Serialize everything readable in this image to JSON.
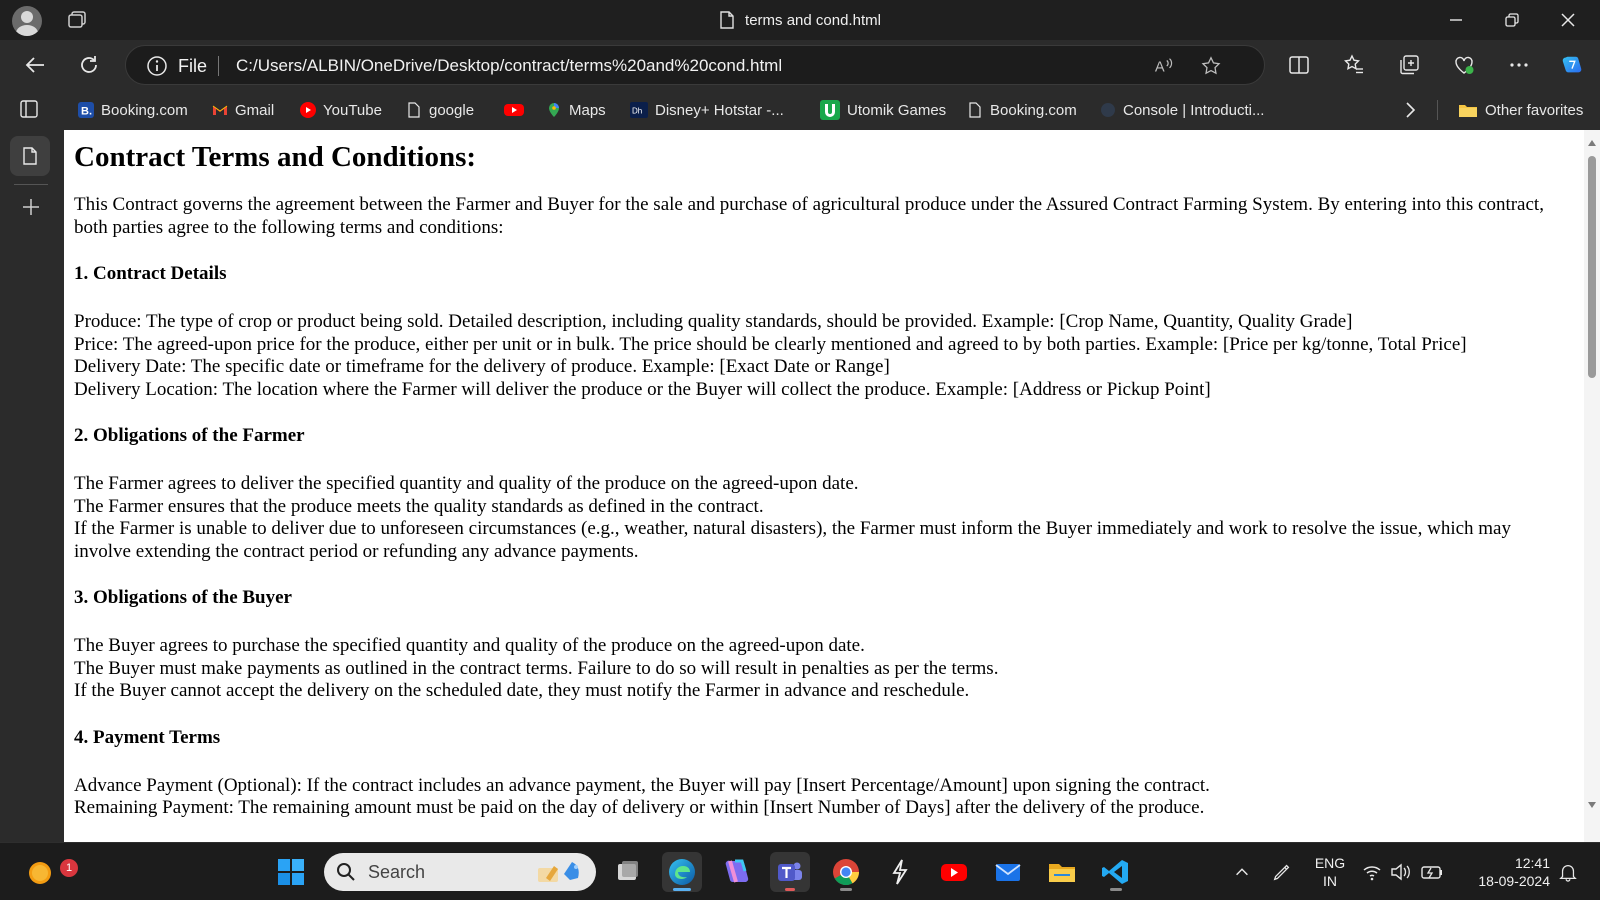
{
  "window": {
    "title": "terms and cond.html"
  },
  "addressbar": {
    "scheme_label": "File",
    "url": "C:/Users/ALBIN/OneDrive/Desktop/contract/terms%20and%20cond.html"
  },
  "favorites": [
    {
      "label": "Booking.com",
      "icon": "booking-icon"
    },
    {
      "label": "Gmail",
      "icon": "gmail-icon"
    },
    {
      "label": "YouTube",
      "icon": "youtube-icon"
    },
    {
      "label": "google",
      "icon": "page-icon"
    },
    {
      "label": "",
      "icon": "youtube-icon"
    },
    {
      "label": "Maps",
      "icon": "maps-icon"
    },
    {
      "label": "Disney+ Hotstar -...",
      "icon": "hotstar-icon"
    },
    {
      "label": "Utomik Games",
      "icon": "utomik-icon"
    },
    {
      "label": "Booking.com",
      "icon": "page-icon"
    },
    {
      "label": "Console | Introducti...",
      "icon": "console-icon"
    }
  ],
  "favorites_other": "Other favorites",
  "document": {
    "heading": "Contract Terms and Conditions:",
    "intro": "This Contract governs the agreement between the Farmer and Buyer for the sale and purchase of agricultural produce under the Assured Contract Farming System. By entering into this contract, both parties agree to the following terms and conditions:",
    "sections": [
      {
        "title": "1. Contract Details",
        "lines": [
          "Produce: The type of crop or product being sold. Detailed description, including quality standards, should be provided. Example: [Crop Name, Quantity, Quality Grade]",
          "Price: The agreed-upon price for the produce, either per unit or in bulk. The price should be clearly mentioned and agreed to by both parties. Example: [Price per kg/tonne, Total Price]",
          "Delivery Date: The specific date or timeframe for the delivery of produce. Example: [Exact Date or Range]",
          "Delivery Location: The location where the Farmer will deliver the produce or the Buyer will collect the produce. Example: [Address or Pickup Point]"
        ]
      },
      {
        "title": "2. Obligations of the Farmer",
        "lines": [
          "The Farmer agrees to deliver the specified quantity and quality of the produce on the agreed-upon date.",
          "The Farmer ensures that the produce meets the quality standards as defined in the contract.",
          "If the Farmer is unable to deliver due to unforeseen circumstances (e.g., weather, natural disasters), the Farmer must inform the Buyer immediately and work to resolve the issue, which may involve extending the contract period or refunding any advance payments."
        ]
      },
      {
        "title": "3. Obligations of the Buyer",
        "lines": [
          "The Buyer agrees to purchase the specified quantity and quality of the produce on the agreed-upon date.",
          "The Buyer must make payments as outlined in the contract terms. Failure to do so will result in penalties as per the terms.",
          "If the Buyer cannot accept the delivery on the scheduled date, they must notify the Farmer in advance and reschedule."
        ]
      },
      {
        "title": "4. Payment Terms",
        "lines": [
          "Advance Payment (Optional): If the contract includes an advance payment, the Buyer will pay [Insert Percentage/Amount] upon signing the contract.",
          "Remaining Payment: The remaining amount must be paid on the day of delivery or within [Insert Number of Days] after the delivery of the produce."
        ]
      }
    ]
  },
  "taskbar": {
    "search_placeholder": "Search",
    "notification_count": "1",
    "language_top": "ENG",
    "language_bottom": "IN",
    "time": "12:41",
    "date": "18-09-2024"
  },
  "colors": {
    "chrome_dark": "#1f1f1f",
    "toolbar": "#2b2b2b",
    "page_bg": "#ffffff",
    "edge_accent": "#5ab0f0"
  }
}
